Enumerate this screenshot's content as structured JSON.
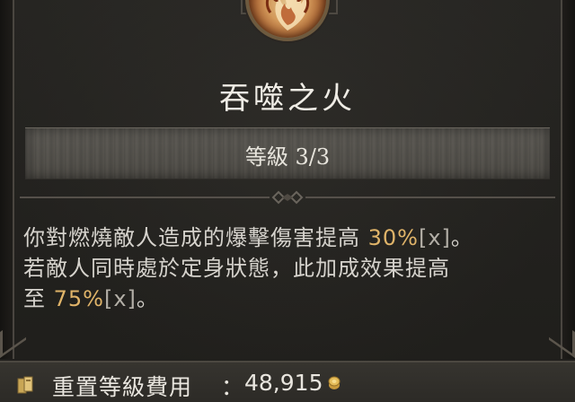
{
  "skill": {
    "name": "吞噬之火",
    "icon": "flame-skill-icon"
  },
  "rank": {
    "label": "等級 3/3"
  },
  "description": {
    "line1_text": "你對燃燒敵人造成的爆擊傷害提高 ",
    "line1_value": "30%",
    "line1_tag": "[x]",
    "line1_end": "。",
    "line2_text": "若敵人同時處於定身狀態，此加成效果提高",
    "line3_text": "至 ",
    "line3_value": "75%",
    "line3_tag": "[x]",
    "line3_end": "。"
  },
  "cost": {
    "label": "重置等級費用",
    "colon": "：",
    "value": "48,915",
    "icon": "gold-coin-icon"
  },
  "colors": {
    "highlight": "#e0b469",
    "text": "#d6d3cd",
    "background": "#22211e"
  }
}
